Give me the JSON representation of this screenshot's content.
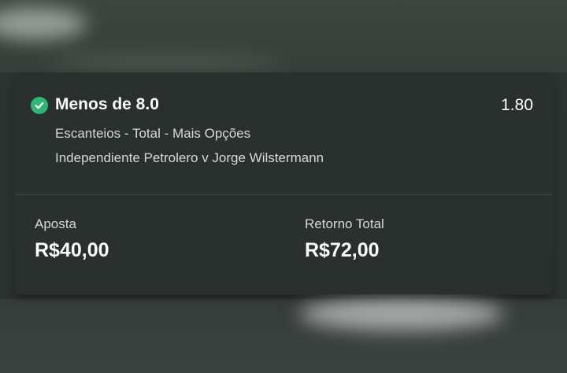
{
  "selection": {
    "name": "Menos de 8.0",
    "odds": "1.80",
    "market": "Escanteios - Total - Mais Opções",
    "event": "Independiente Petrolero v Jorge Wilstermann",
    "status_icon": "check-circle-icon",
    "status_color": "#2fb574"
  },
  "stake": {
    "label": "Aposta",
    "value": "R$40,00"
  },
  "total_return": {
    "label": "Retorno Total",
    "value": "R$72,00"
  }
}
